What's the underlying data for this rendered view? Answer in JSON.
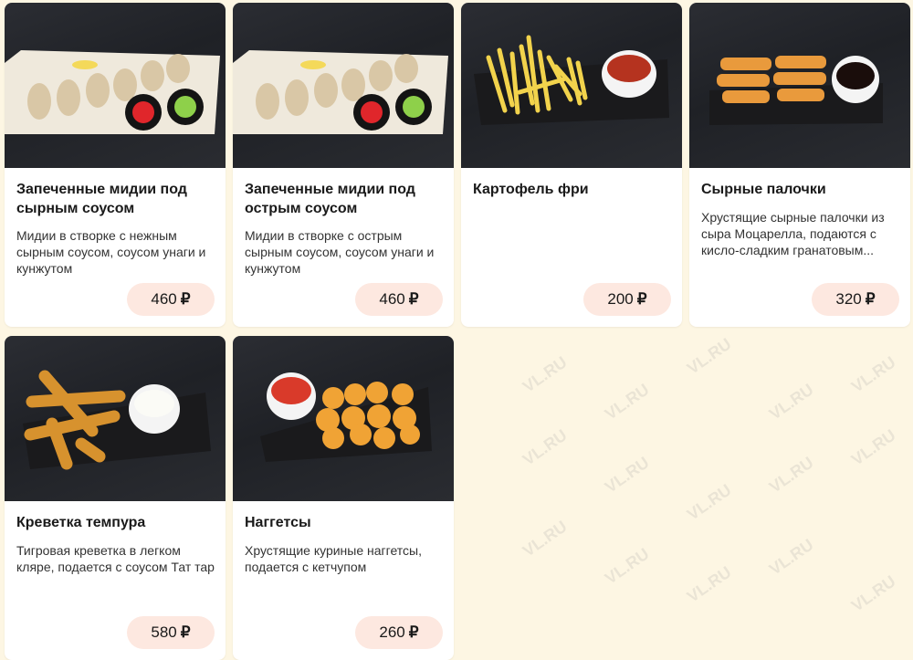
{
  "currency": "₽",
  "cards": [
    {
      "title": "Запеченные мидии под сырным соусом",
      "description": "Мидии в створке с нежным сырным соусом, соусом унаги и кунжутом",
      "price": "460"
    },
    {
      "title": "Запеченные мидии под острым соусом",
      "description": "Мидии в створке с острым сырным соусом, соусом унаги и кунжутом",
      "price": "460"
    },
    {
      "title": "Картофель фри",
      "description": "",
      "price": "200"
    },
    {
      "title": "Сырные палочки",
      "description": "Хрустящие сырные палочки из сыра Моцарелла, подаются с кисло-сладким гранатовым...",
      "price": "320"
    },
    {
      "title": "Креветка темпура",
      "description": "Тигровая креветка в легком кляре, подается с соусом Тат тар",
      "price": "580"
    },
    {
      "title": "Наггетсы",
      "description": "Хрустящие куриные наггетсы, подается с кетчупом",
      "price": "260"
    }
  ],
  "watermark": "VL.RU"
}
